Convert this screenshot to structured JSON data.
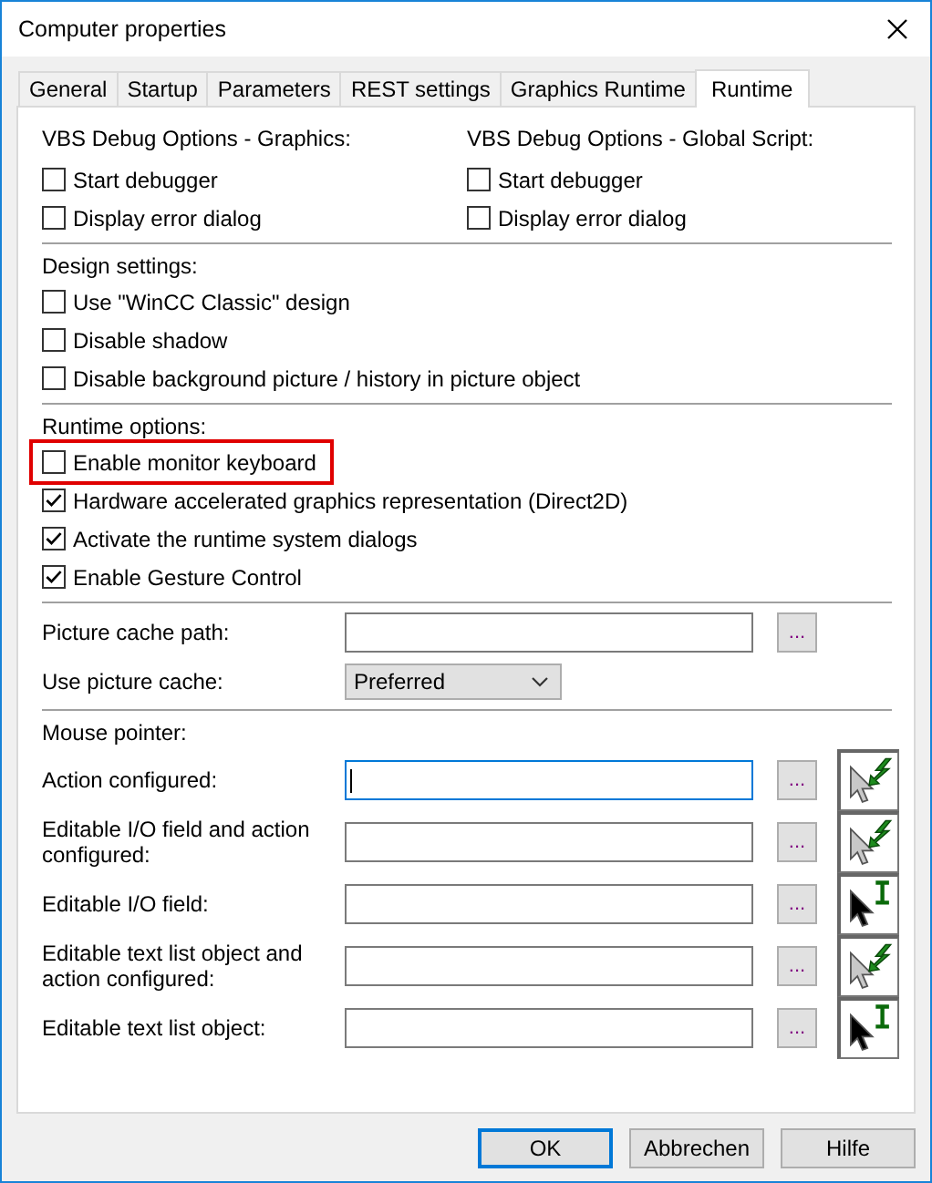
{
  "window": {
    "title": "Computer properties"
  },
  "tabs": [
    {
      "label": "General",
      "selected": false
    },
    {
      "label": "Startup",
      "selected": false
    },
    {
      "label": "Parameters",
      "selected": false
    },
    {
      "label": "REST settings",
      "selected": false
    },
    {
      "label": "Graphics Runtime",
      "selected": false
    },
    {
      "label": "Runtime",
      "selected": true
    }
  ],
  "vbs_debug": [
    {
      "heading": "VBS Debug Options - Graphics:",
      "options": [
        {
          "label": "Start debugger",
          "checked": false
        },
        {
          "label": "Display error dialog",
          "checked": false
        }
      ]
    },
    {
      "heading": "VBS Debug Options - Global Script:",
      "options": [
        {
          "label": "Start debugger",
          "checked": false
        },
        {
          "label": "Display error dialog",
          "checked": false
        }
      ]
    }
  ],
  "design_settings": {
    "heading": "Design settings:",
    "options": [
      {
        "label": "Use \"WinCC Classic\" design",
        "checked": false
      },
      {
        "label": "Disable shadow",
        "checked": false
      },
      {
        "label": "Disable background picture / history in picture object",
        "checked": false
      }
    ]
  },
  "runtime_options": {
    "heading": "Runtime options:",
    "options": [
      {
        "label": "Enable monitor keyboard",
        "checked": false,
        "highlighted": true
      },
      {
        "label": "Hardware accelerated graphics representation (Direct2D)",
        "checked": true,
        "highlighted": false
      },
      {
        "label": "Activate the runtime system dialogs",
        "checked": true,
        "highlighted": false
      },
      {
        "label": "Enable Gesture Control",
        "checked": true,
        "highlighted": false
      }
    ]
  },
  "picture_cache": {
    "path_label": "Picture cache path:",
    "browse_button": "...",
    "use_label": "Use picture cache:",
    "use_value": "Preferred"
  },
  "mouse_pointer": {
    "heading": "Mouse pointer:",
    "rows": [
      {
        "label": "Action configured:",
        "focused": true,
        "browse_button": "...",
        "kind": "lightning"
      },
      {
        "label": "Editable I/O field and action configured:",
        "focused": false,
        "browse_button": "...",
        "kind": "lightning"
      },
      {
        "label": "Editable I/O field:",
        "focused": false,
        "browse_button": "...",
        "kind": "ibeam"
      },
      {
        "label": "Editable text list object and action configured:",
        "focused": false,
        "browse_button": "...",
        "kind": "lightning"
      },
      {
        "label": "Editable text list object:",
        "focused": false,
        "browse_button": "...",
        "kind": "ibeam"
      }
    ]
  },
  "buttons": [
    {
      "label": "OK",
      "default": true
    },
    {
      "label": "Abbrechen",
      "default": false
    },
    {
      "label": "Hilfe",
      "default": false
    }
  ]
}
